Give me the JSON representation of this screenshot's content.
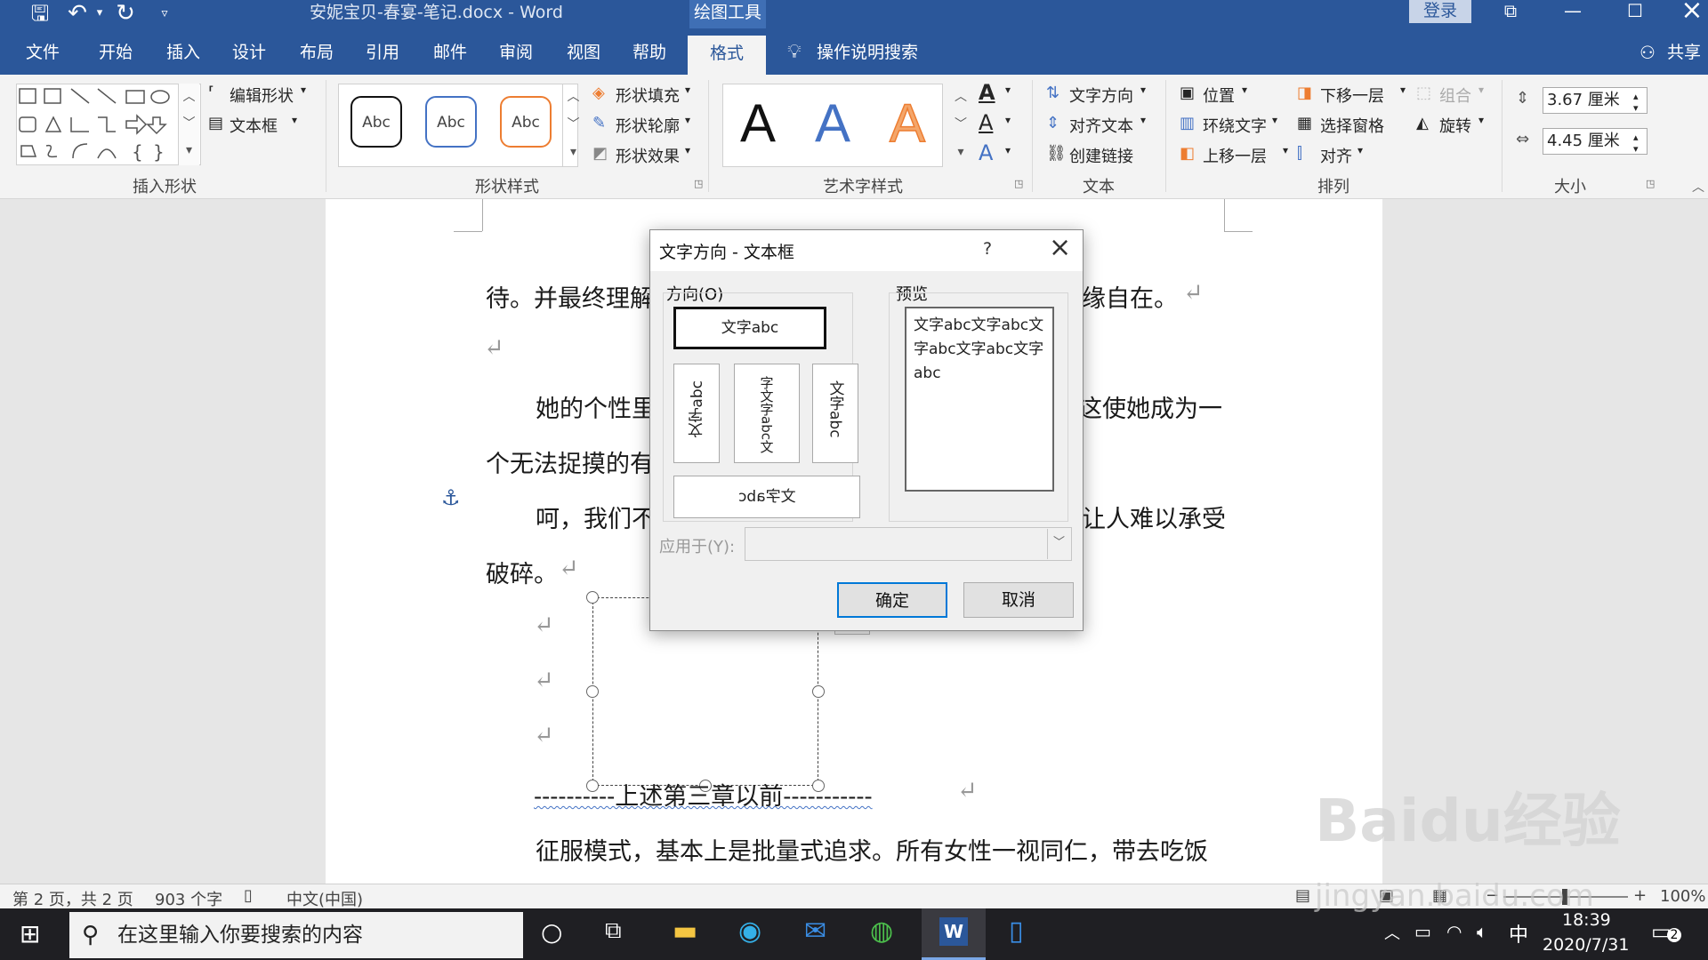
{
  "titlebar": {
    "title": "安妮宝贝-春宴-笔记.docx - Word",
    "contextual_tab": "绘图工具",
    "login": "登录"
  },
  "tabs": [
    {
      "label": "文件"
    },
    {
      "label": "开始"
    },
    {
      "label": "插入"
    },
    {
      "label": "设计"
    },
    {
      "label": "布局"
    },
    {
      "label": "引用"
    },
    {
      "label": "邮件"
    },
    {
      "label": "审阅"
    },
    {
      "label": "视图"
    },
    {
      "label": "帮助"
    },
    {
      "label": "格式"
    }
  ],
  "tell_me": "操作说明搜索",
  "share": "共享",
  "ribbon": {
    "insert_shapes": {
      "label": "插入形状",
      "edit_shape": "编辑形状",
      "text_box": "文本框"
    },
    "shape_styles": {
      "label": "形状样式",
      "sample": "Abc",
      "fill": "形状填充",
      "outline": "形状轮廓",
      "effects": "形状效果"
    },
    "wordart": {
      "label": "艺术字样式",
      "letter": "A"
    },
    "text": {
      "label": "文本",
      "direction": "文字方向",
      "align": "对齐文本",
      "link": "创建链接"
    },
    "arrange": {
      "label": "排列",
      "position": "位置",
      "wrap": "环绕文字",
      "bring_forward": "上移一层",
      "send_backward": "下移一层",
      "selection_pane": "选择窗格",
      "align": "对齐",
      "group": "组合",
      "rotate": "旋转"
    },
    "size": {
      "label": "大小",
      "height": "3.67 厘米",
      "width": "4.45 厘米"
    }
  },
  "document": {
    "lines": [
      {
        "l": "待。并最终理解",
        "r": "缘自在。"
      },
      {
        "l": "她的个性里",
        "r": "这使她成为一"
      },
      {
        "l": "个无法捉摸的有",
        "r": ""
      },
      {
        "l": "呵，我们不",
        "r": "让人难以承受"
      },
      {
        "l": "破碎。",
        "r": ""
      }
    ],
    "dashed_line": "----------上述第三章以前-----------",
    "last_line": "征服模式，基本上是批量式追求。所有女性一视同仁，带去吃饭"
  },
  "dialog": {
    "title": "文字方向 - 文本框",
    "help": "?",
    "direction_label": "方向(O)",
    "preview_label": "预览",
    "options": {
      "horizontal": "文字abc",
      "vertical_rotated": "文字abc",
      "vertical_stacked": "字文字abc文",
      "vertical_right": "文字abc",
      "upside": "文字abc"
    },
    "preview_text": "文字abc文字abc文字abc文字abc文字abc",
    "apply_label": "应用于(Y):",
    "apply_value": "",
    "ok": "确定",
    "cancel": "取消"
  },
  "statusbar": {
    "page": "第 2 页，共 2 页",
    "words": "903 个字",
    "lang": "中文(中国)",
    "zoom": "100%"
  },
  "taskbar": {
    "search_placeholder": "在这里输入你要搜索的内容",
    "ime": "中",
    "time": "18:39",
    "date": "2020/7/31",
    "notifications": "2"
  },
  "watermark": {
    "brand": "Baidu经验",
    "url": "jingyan.baidu.com"
  },
  "colors": {
    "accent": "#2b579a",
    "taskbar": "#1f1f23",
    "dialog_ok_border": "#0078d7"
  }
}
